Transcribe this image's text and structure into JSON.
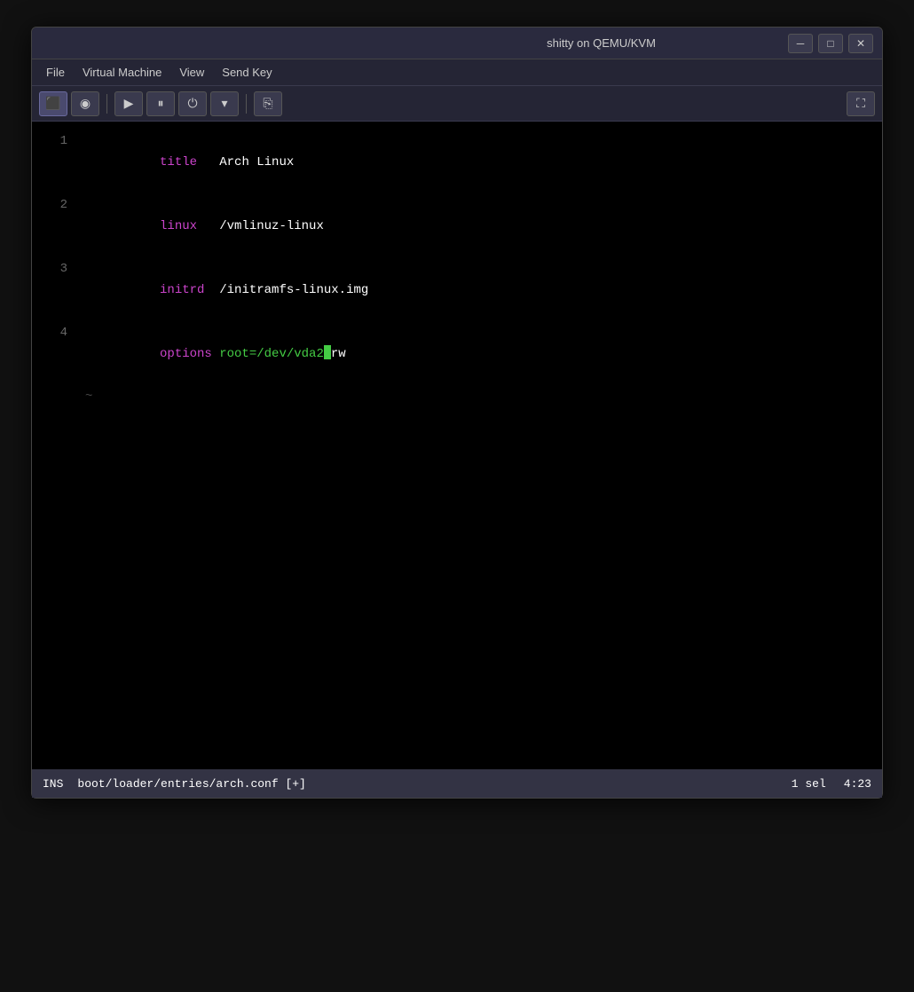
{
  "window": {
    "title": "shitty on QEMU/KVM",
    "minimize_label": "─",
    "maximize_label": "□",
    "close_label": "✕"
  },
  "menubar": {
    "items": [
      {
        "label": "File"
      },
      {
        "label": "Virtual Machine"
      },
      {
        "label": "View"
      },
      {
        "label": "Send Key"
      }
    ]
  },
  "toolbar": {
    "monitor_icon": "▬",
    "light_icon": "◉",
    "play_icon": "▶",
    "pause_icon": "⏸",
    "power_icon": "⏻",
    "dropdown_icon": "▾",
    "usb_icon": "⎘",
    "fullscreen_icon": "⛶"
  },
  "editor": {
    "lines": [
      {
        "number": "1",
        "parts": [
          {
            "text": "title",
            "class": "kw-title"
          },
          {
            "text": "   Arch Linux",
            "class": "val-white"
          }
        ]
      },
      {
        "number": "2",
        "parts": [
          {
            "text": "linux",
            "class": "kw-linux"
          },
          {
            "text": "   /vmlinuz-linux",
            "class": "val-white"
          }
        ]
      },
      {
        "number": "3",
        "parts": [
          {
            "text": "initrd",
            "class": "kw-initrd"
          },
          {
            "text": "  /initramfs-linux.img",
            "class": "val-white"
          }
        ]
      },
      {
        "number": "4",
        "parts": [
          {
            "text": "options",
            "class": "kw-options"
          },
          {
            "text": " root=/dev/vda2",
            "class": "val-green"
          },
          {
            "text": "CURSOR",
            "class": "cursor"
          },
          {
            "text": "rw",
            "class": "val-white"
          }
        ]
      }
    ],
    "tilde": "~"
  },
  "statusbar": {
    "mode": "INS",
    "file": "boot/loader/entries/arch.conf [+]",
    "position": "1 sel",
    "time": "4:23"
  }
}
